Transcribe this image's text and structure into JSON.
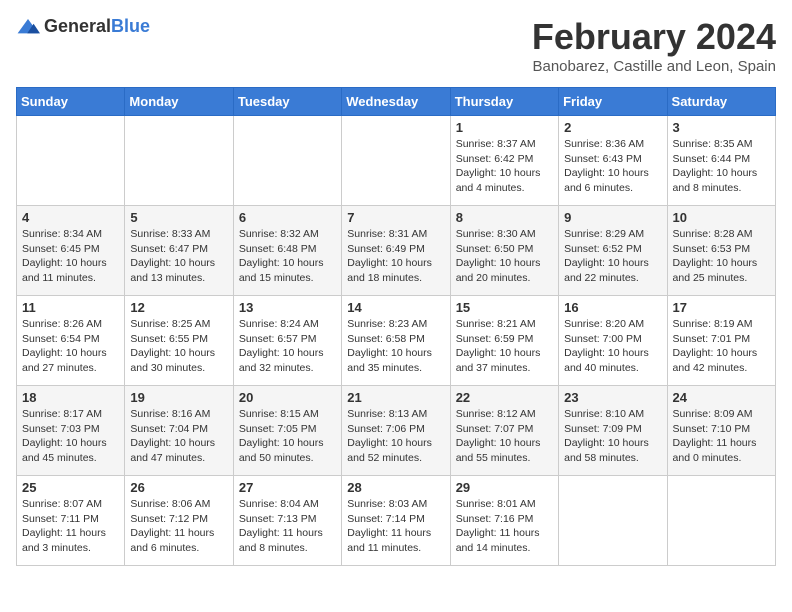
{
  "header": {
    "logo_general": "General",
    "logo_blue": "Blue",
    "month": "February 2024",
    "location": "Banobarez, Castille and Leon, Spain"
  },
  "weekdays": [
    "Sunday",
    "Monday",
    "Tuesday",
    "Wednesday",
    "Thursday",
    "Friday",
    "Saturday"
  ],
  "weeks": [
    [
      {
        "day": "",
        "info": ""
      },
      {
        "day": "",
        "info": ""
      },
      {
        "day": "",
        "info": ""
      },
      {
        "day": "",
        "info": ""
      },
      {
        "day": "1",
        "info": "Sunrise: 8:37 AM\nSunset: 6:42 PM\nDaylight: 10 hours\nand 4 minutes."
      },
      {
        "day": "2",
        "info": "Sunrise: 8:36 AM\nSunset: 6:43 PM\nDaylight: 10 hours\nand 6 minutes."
      },
      {
        "day": "3",
        "info": "Sunrise: 8:35 AM\nSunset: 6:44 PM\nDaylight: 10 hours\nand 8 minutes."
      }
    ],
    [
      {
        "day": "4",
        "info": "Sunrise: 8:34 AM\nSunset: 6:45 PM\nDaylight: 10 hours\nand 11 minutes."
      },
      {
        "day": "5",
        "info": "Sunrise: 8:33 AM\nSunset: 6:47 PM\nDaylight: 10 hours\nand 13 minutes."
      },
      {
        "day": "6",
        "info": "Sunrise: 8:32 AM\nSunset: 6:48 PM\nDaylight: 10 hours\nand 15 minutes."
      },
      {
        "day": "7",
        "info": "Sunrise: 8:31 AM\nSunset: 6:49 PM\nDaylight: 10 hours\nand 18 minutes."
      },
      {
        "day": "8",
        "info": "Sunrise: 8:30 AM\nSunset: 6:50 PM\nDaylight: 10 hours\nand 20 minutes."
      },
      {
        "day": "9",
        "info": "Sunrise: 8:29 AM\nSunset: 6:52 PM\nDaylight: 10 hours\nand 22 minutes."
      },
      {
        "day": "10",
        "info": "Sunrise: 8:28 AM\nSunset: 6:53 PM\nDaylight: 10 hours\nand 25 minutes."
      }
    ],
    [
      {
        "day": "11",
        "info": "Sunrise: 8:26 AM\nSunset: 6:54 PM\nDaylight: 10 hours\nand 27 minutes."
      },
      {
        "day": "12",
        "info": "Sunrise: 8:25 AM\nSunset: 6:55 PM\nDaylight: 10 hours\nand 30 minutes."
      },
      {
        "day": "13",
        "info": "Sunrise: 8:24 AM\nSunset: 6:57 PM\nDaylight: 10 hours\nand 32 minutes."
      },
      {
        "day": "14",
        "info": "Sunrise: 8:23 AM\nSunset: 6:58 PM\nDaylight: 10 hours\nand 35 minutes."
      },
      {
        "day": "15",
        "info": "Sunrise: 8:21 AM\nSunset: 6:59 PM\nDaylight: 10 hours\nand 37 minutes."
      },
      {
        "day": "16",
        "info": "Sunrise: 8:20 AM\nSunset: 7:00 PM\nDaylight: 10 hours\nand 40 minutes."
      },
      {
        "day": "17",
        "info": "Sunrise: 8:19 AM\nSunset: 7:01 PM\nDaylight: 10 hours\nand 42 minutes."
      }
    ],
    [
      {
        "day": "18",
        "info": "Sunrise: 8:17 AM\nSunset: 7:03 PM\nDaylight: 10 hours\nand 45 minutes."
      },
      {
        "day": "19",
        "info": "Sunrise: 8:16 AM\nSunset: 7:04 PM\nDaylight: 10 hours\nand 47 minutes."
      },
      {
        "day": "20",
        "info": "Sunrise: 8:15 AM\nSunset: 7:05 PM\nDaylight: 10 hours\nand 50 minutes."
      },
      {
        "day": "21",
        "info": "Sunrise: 8:13 AM\nSunset: 7:06 PM\nDaylight: 10 hours\nand 52 minutes."
      },
      {
        "day": "22",
        "info": "Sunrise: 8:12 AM\nSunset: 7:07 PM\nDaylight: 10 hours\nand 55 minutes."
      },
      {
        "day": "23",
        "info": "Sunrise: 8:10 AM\nSunset: 7:09 PM\nDaylight: 10 hours\nand 58 minutes."
      },
      {
        "day": "24",
        "info": "Sunrise: 8:09 AM\nSunset: 7:10 PM\nDaylight: 11 hours\nand 0 minutes."
      }
    ],
    [
      {
        "day": "25",
        "info": "Sunrise: 8:07 AM\nSunset: 7:11 PM\nDaylight: 11 hours\nand 3 minutes."
      },
      {
        "day": "26",
        "info": "Sunrise: 8:06 AM\nSunset: 7:12 PM\nDaylight: 11 hours\nand 6 minutes."
      },
      {
        "day": "27",
        "info": "Sunrise: 8:04 AM\nSunset: 7:13 PM\nDaylight: 11 hours\nand 8 minutes."
      },
      {
        "day": "28",
        "info": "Sunrise: 8:03 AM\nSunset: 7:14 PM\nDaylight: 11 hours\nand 11 minutes."
      },
      {
        "day": "29",
        "info": "Sunrise: 8:01 AM\nSunset: 7:16 PM\nDaylight: 11 hours\nand 14 minutes."
      },
      {
        "day": "",
        "info": ""
      },
      {
        "day": "",
        "info": ""
      }
    ]
  ]
}
